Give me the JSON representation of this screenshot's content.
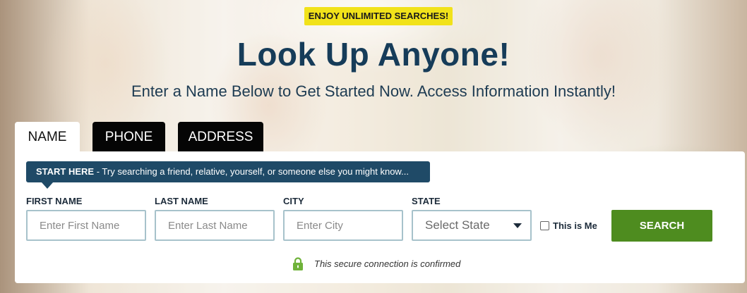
{
  "promo": {
    "badge": "ENJOY UNLIMITED SEARCHES!"
  },
  "hero": {
    "title": "Look Up Anyone!",
    "subtitle": "Enter a Name Below to Get Started Now. Access Information Instantly!"
  },
  "tabs": [
    {
      "label": "NAME",
      "active": true
    },
    {
      "label": "PHONE",
      "active": false
    },
    {
      "label": "ADDRESS",
      "active": false
    }
  ],
  "tip": {
    "strong": "START HERE",
    "text": " - Try searching a friend, relative, yourself, or someone else you might know..."
  },
  "form": {
    "first_name": {
      "label": "FIRST NAME",
      "placeholder": "Enter First Name"
    },
    "last_name": {
      "label": "LAST NAME",
      "placeholder": "Enter Last Name"
    },
    "city": {
      "label": "CITY",
      "placeholder": "Enter City"
    },
    "state": {
      "label": "STATE",
      "selected": "Select State"
    },
    "this_is_me": {
      "label": "This is Me",
      "checked": false
    },
    "search_label": "SEARCH"
  },
  "secure": {
    "text": "This secure connection is confirmed",
    "icon": "lock-icon"
  },
  "colors": {
    "badge": "#f1e21a",
    "title": "#163c59",
    "tip_bg": "#1f4a67",
    "search_bg": "#4e8c1f",
    "lock": "#6fb23a"
  }
}
